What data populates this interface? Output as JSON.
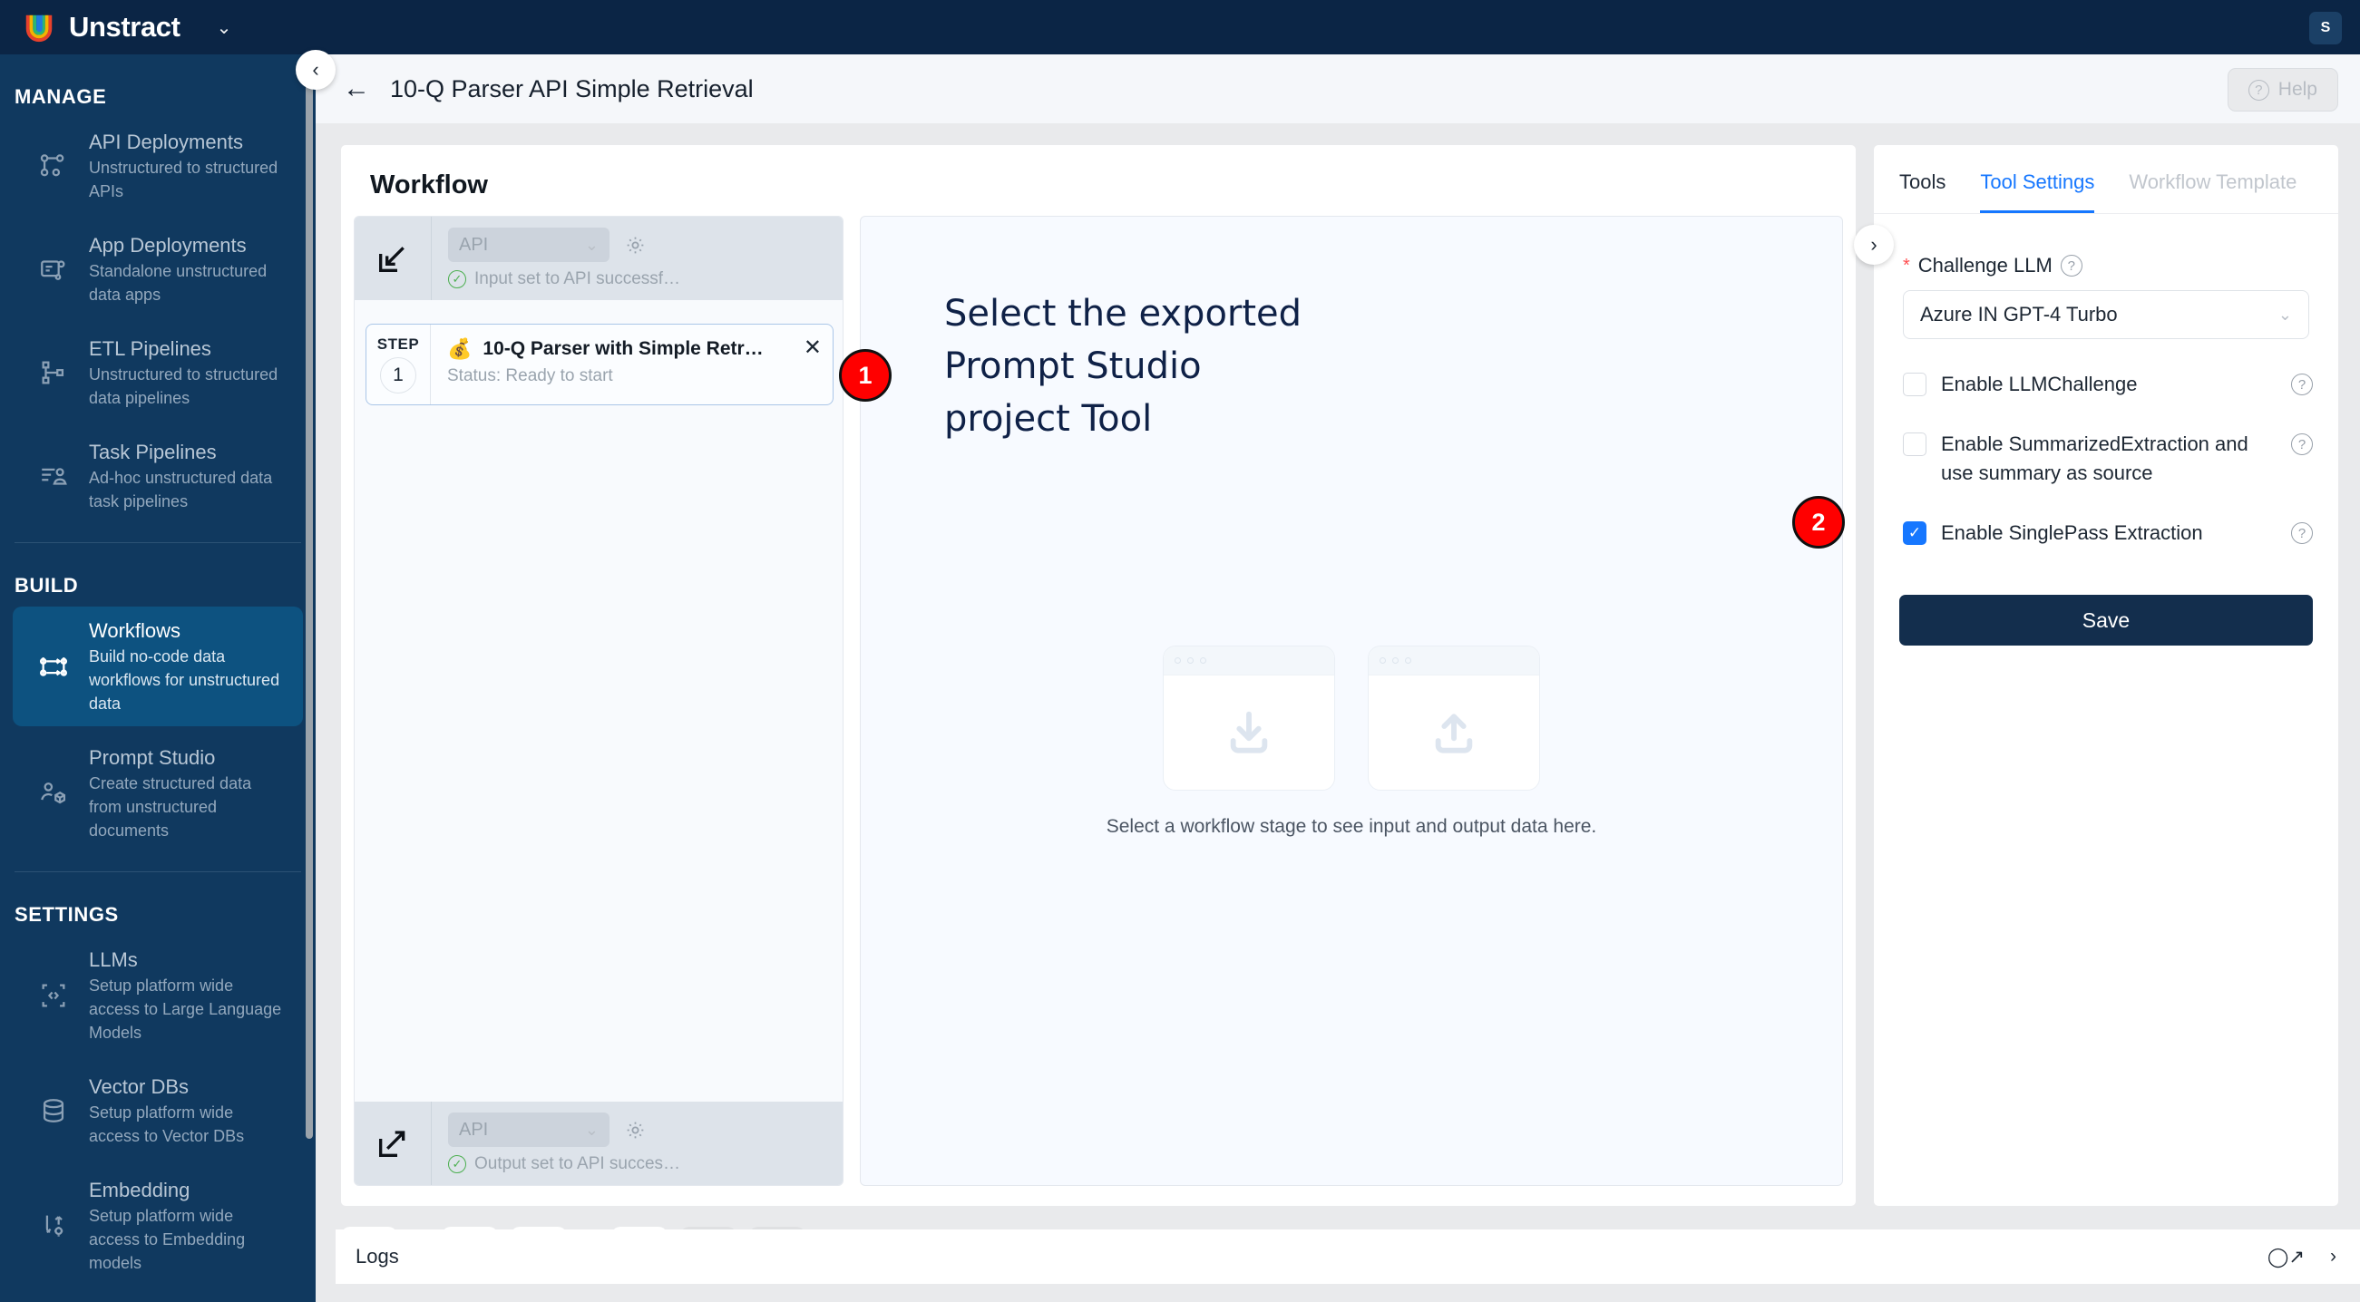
{
  "topbar": {
    "brand": "Unstract",
    "brand_caret_icon": "chevron-down-icon",
    "avatar_initial": "S"
  },
  "sidebar": {
    "sections": [
      {
        "label": "MANAGE",
        "items": [
          {
            "title": "API Deployments",
            "subtitle": "Unstructured to structured APIs",
            "icon": "api-deployments-icon",
            "active": false
          },
          {
            "title": "App Deployments",
            "subtitle": "Standalone unstructured data apps",
            "icon": "app-deployments-icon",
            "active": false
          },
          {
            "title": "ETL Pipelines",
            "subtitle": "Unstructured to structured data pipelines",
            "icon": "etl-pipelines-icon",
            "active": false
          },
          {
            "title": "Task Pipelines",
            "subtitle": "Ad-hoc unstructured data task pipelines",
            "icon": "task-pipelines-icon",
            "active": false
          }
        ]
      },
      {
        "label": "BUILD",
        "items": [
          {
            "title": "Workflows",
            "subtitle": "Build no-code data workflows for unstructured data",
            "icon": "workflows-icon",
            "active": true
          },
          {
            "title": "Prompt Studio",
            "subtitle": "Create structured data from unstructured documents",
            "icon": "prompt-studio-icon",
            "active": false
          }
        ]
      },
      {
        "label": "SETTINGS",
        "items": [
          {
            "title": "LLMs",
            "subtitle": "Setup platform wide access to Large Language Models",
            "icon": "llms-icon",
            "active": false
          },
          {
            "title": "Vector DBs",
            "subtitle": "Setup platform wide access to Vector DBs",
            "icon": "vector-dbs-icon",
            "active": false
          },
          {
            "title": "Embedding",
            "subtitle": "Setup platform wide access to Embedding models",
            "icon": "embedding-icon",
            "active": false
          }
        ]
      }
    ]
  },
  "header": {
    "back_icon": "back-arrow-icon",
    "title": "10-Q Parser API Simple Retrieval",
    "help_label": "Help",
    "help_icon": "question-circle-icon",
    "collapse_icon": "chevron-left-icon"
  },
  "workflow": {
    "heading": "Workflow",
    "input_node": {
      "icon": "input-import-icon",
      "select_value": "API",
      "select_caret_icon": "chevron-down-icon",
      "gear_icon": "gear-icon",
      "status": "Input set to API successf…",
      "status_icon": "check-circle-icon"
    },
    "step": {
      "step_word": "STEP",
      "step_number": "1",
      "emoji": "💰",
      "title": "10-Q Parser with Simple Retr…",
      "status": "Status: Ready to start",
      "close_icon": "close-icon"
    },
    "output_node": {
      "icon": "output-export-icon",
      "select_value": "API",
      "select_caret_icon": "chevron-down-icon",
      "gear_icon": "gear-icon",
      "status": "Output set to API succes…",
      "status_icon": "check-circle-icon"
    },
    "hint_line1": "Select the exported",
    "hint_line2": "Prompt Studio",
    "hint_line3": "project Tool",
    "placeholder_caption": "Select a workflow stage to see input and output data here.",
    "placeholder_icons": [
      "download-icon",
      "upload-icon"
    ]
  },
  "tools_panel": {
    "tabs": [
      {
        "label": "Tools",
        "state": "normal"
      },
      {
        "label": "Tool Settings",
        "state": "active"
      },
      {
        "label": "Workflow Template",
        "state": "muted"
      }
    ],
    "expand_icon": "chevron-right-icon",
    "challenge_llm": {
      "label": "Challenge LLM",
      "required_marker": "*",
      "help_icon": "question-circle-icon",
      "selected_value": "Azure IN GPT-4 Turbo",
      "caret_icon": "chevron-down-icon"
    },
    "checkboxes": [
      {
        "label": "Enable LLMChallenge",
        "checked": false,
        "help_icon": "question-circle-icon"
      },
      {
        "label": "Enable SummarizedExtraction and use summary as source",
        "checked": false,
        "help_icon": "question-circle-icon"
      },
      {
        "label": "Enable SinglePass Extraction",
        "checked": true,
        "help_icon": "question-circle-icon"
      }
    ],
    "save_label": "Save"
  },
  "bottom_toolbar": {
    "buttons": [
      {
        "icon": "play-circle-icon",
        "disabled": false
      },
      {
        "icon": "clear-brush-icon",
        "disabled": false
      },
      {
        "icon": "history-clock-icon",
        "disabled": false
      },
      {
        "icon": "plug-connect-icon",
        "disabled": false
      },
      {
        "icon": "share-nodes-icon",
        "disabled": true
      },
      {
        "icon": "plug-disconnect-icon",
        "disabled": true
      }
    ]
  },
  "logs": {
    "label": "Logs",
    "expand_icon": "expand-icon",
    "chevron_icon": "chevron-right-icon"
  },
  "annotations": [
    {
      "number": "1",
      "target": "workflow-step-card"
    },
    {
      "number": "2",
      "target": "enable-singlepass-extraction-checkbox"
    }
  ],
  "colors": {
    "brand_navy": "#0b2545",
    "sidebar_blue": "#10395f",
    "sidebar_active": "#0d5280",
    "accent_blue": "#1677ff",
    "save_button": "#132e4d",
    "annotation_red": "#ff0000",
    "status_green": "#4caf50"
  }
}
